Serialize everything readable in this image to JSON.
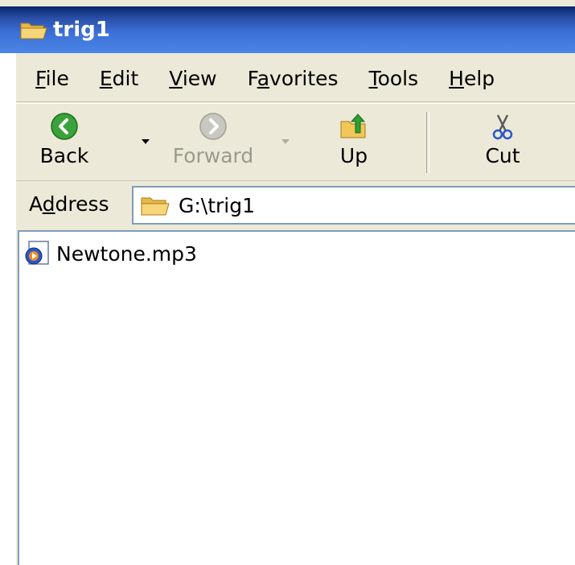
{
  "window": {
    "title": "trig1"
  },
  "menu": {
    "items": [
      {
        "label_pre": "",
        "label_u": "F",
        "label_post": "ile"
      },
      {
        "label_pre": "",
        "label_u": "E",
        "label_post": "dit"
      },
      {
        "label_pre": "",
        "label_u": "V",
        "label_post": "iew"
      },
      {
        "label_pre": "F",
        "label_u": "a",
        "label_post": "vorites"
      },
      {
        "label_pre": "",
        "label_u": "T",
        "label_post": "ools"
      },
      {
        "label_pre": "",
        "label_u": "H",
        "label_post": "elp"
      }
    ]
  },
  "toolbar": {
    "back_label": "Back",
    "forward_label": "Forward",
    "up_label": "Up",
    "cut_label": "Cut"
  },
  "address": {
    "label_pre": "A",
    "label_u": "d",
    "label_post": "dress",
    "value": "G:\\trig1"
  },
  "files": [
    {
      "name": "Newtone.mp3",
      "icon": "media-file-icon"
    }
  ],
  "colors": {
    "titlebar": "#2a4fa8",
    "chrome": "#ece9d8",
    "back_green": "#3aa23a",
    "up_green": "#2f9e2f"
  }
}
